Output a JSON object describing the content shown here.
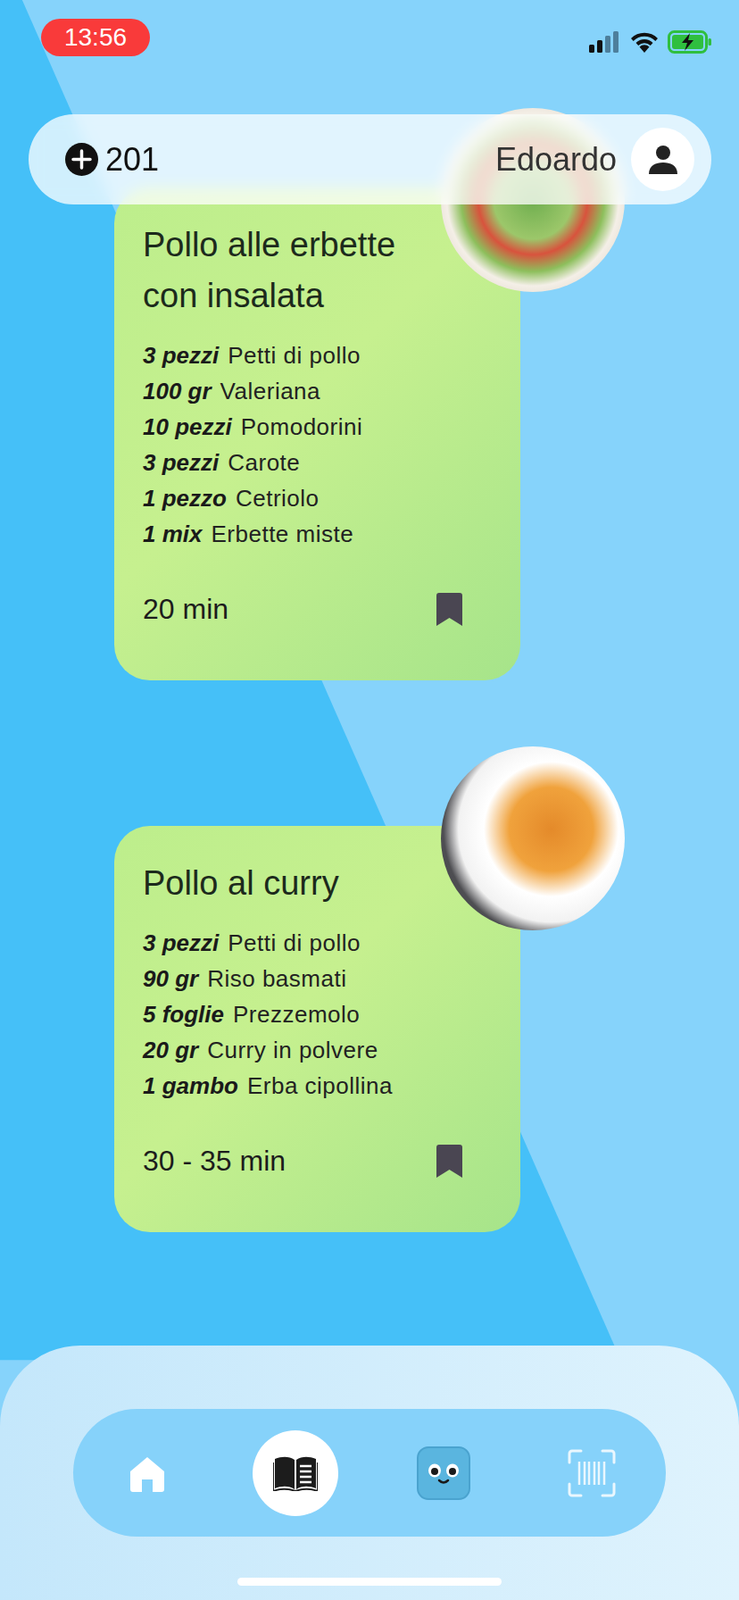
{
  "status_bar": {
    "time": "13:56"
  },
  "header": {
    "points": "201",
    "user": "Edoardo"
  },
  "recipes": [
    {
      "title": "Pollo alle erbette con insalata",
      "ingredients": [
        {
          "quantity": "3 pezzi",
          "name": "Petti di pollo"
        },
        {
          "quantity": "100 gr",
          "name": "Valeriana"
        },
        {
          "quantity": "10 pezzi",
          "name": "Pomodorini"
        },
        {
          "quantity": "3 pezzi",
          "name": "Carote"
        },
        {
          "quantity": "1 pezzo",
          "name": "Cetriolo"
        },
        {
          "quantity": "1 mix",
          "name": "Erbette miste"
        }
      ],
      "time": "20 min",
      "bookmarked": true,
      "photo": "salad"
    },
    {
      "title": "Pollo al curry",
      "ingredients": [
        {
          "quantity": "3 pezzi",
          "name": "Petti di pollo"
        },
        {
          "quantity": "90 gr",
          "name": "Riso basmati"
        },
        {
          "quantity": "5 foglie",
          "name": "Prezzemolo"
        },
        {
          "quantity": "20 gr",
          "name": "Curry in polvere"
        },
        {
          "quantity": "1 gambo",
          "name": "Erba cipollina"
        }
      ],
      "time": "30 - 35 min",
      "bookmarked": true,
      "photo": "curry"
    }
  ],
  "nav": [
    {
      "kind": "home",
      "selected": false
    },
    {
      "kind": "recipes",
      "selected": true
    },
    {
      "kind": "mascot",
      "selected": false
    },
    {
      "kind": "scan",
      "selected": false
    }
  ]
}
